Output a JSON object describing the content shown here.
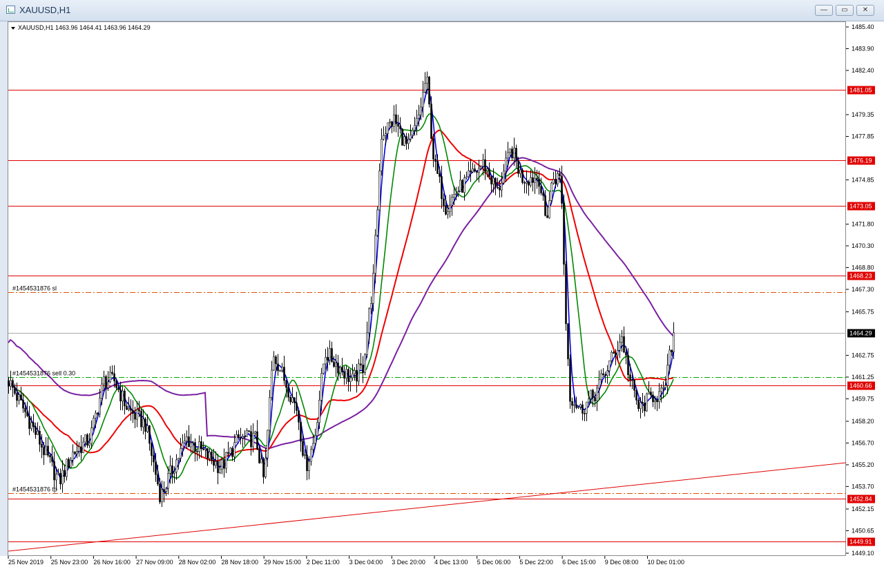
{
  "window": {
    "title": "XAUUSD,H1",
    "minimize_label": "—",
    "restore_label": "▭",
    "close_label": "✕"
  },
  "chart": {
    "info_line": "XAUUSD,H1  1463.96 1464.41 1463.96 1464.29",
    "price_ticks": [
      "1485.40",
      "1483.90",
      "1482.40",
      "1479.35",
      "1477.85",
      "1474.85",
      "1471.80",
      "1470.30",
      "1468.80",
      "1467.30",
      "1465.75",
      "1462.75",
      "1461.25",
      "1459.75",
      "1458.20",
      "1456.70",
      "1455.20",
      "1453.70",
      "1452.15",
      "1450.65",
      "1449.10"
    ],
    "time_labels": [
      "25 Nov 2019",
      "25 Nov 23:00",
      "26 Nov 16:00",
      "27 Nov 09:00",
      "28 Nov 02:00",
      "28 Nov 18:00",
      "29 Nov 15:00",
      "2 Dec 11:00",
      "3 Dec 04:00",
      "3 Dec 20:00",
      "4 Dec 13:00",
      "5 Dec 06:00",
      "5 Dec 22:00",
      "6 Dec 15:00",
      "9 Dec 08:00",
      "10 Dec 01:00"
    ],
    "level_tags": [
      "1481.05",
      "1476.19",
      "1473.05",
      "1468.23",
      "1460.66",
      "1452.84",
      "1449.91"
    ],
    "current_price_tag": "1464.29",
    "order_labels": {
      "sl": "#1454531876 sl",
      "sell": "#1454531876 sell 0.30",
      "tp": "#1454531876 tp"
    },
    "colors": {
      "level_line": "#e00000",
      "ma_fast": "#0000dd",
      "ma_mid": "#008800",
      "ma_slow": "#ee0000",
      "ma_long": "#7a1fa0",
      "sell_line": "#00aa00",
      "candle": "#000000"
    }
  }
}
